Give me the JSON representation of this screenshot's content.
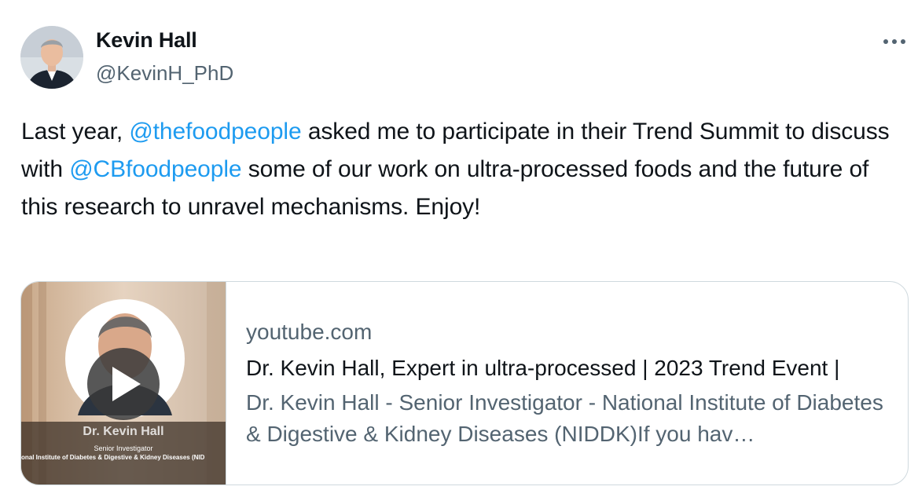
{
  "author": {
    "display_name": "Kevin Hall",
    "handle": "@KevinH_PhD",
    "avatar_icon": "profile-photo"
  },
  "more_icon": "more-horizontal-icon",
  "tweet": {
    "segments": [
      {
        "text": "Last year, ",
        "type": "text"
      },
      {
        "text": "@thefoodpeople",
        "type": "mention"
      },
      {
        "text": " asked me to participate in their Trend Summit to discuss with ",
        "type": "text"
      },
      {
        "text": "@CBfoodpeople",
        "type": "mention"
      },
      {
        "text": " some of our work on ultra-processed foods and the future of this research to unravel mechanisms. Enjoy!",
        "type": "text"
      }
    ]
  },
  "card": {
    "domain": "youtube.com",
    "title": "Dr. Kevin Hall, Expert in ultra-processed | 2023 Trend Event |",
    "description": "Dr. Kevin Hall - Senior Investigator - National Institute of Diabetes & Digestive & Kidney Diseases (NIDDK)If you hav…",
    "thumbnail": {
      "name_text": "Dr. Kevin Hall",
      "role_text": "Senior Investigator",
      "org_text": "onal Institute of Diabetes & Digestive & Kidney Diseases (NID",
      "play_icon": "play-icon"
    }
  },
  "colors": {
    "link": "#1d9bf0",
    "secondary_text": "#536471",
    "primary_text": "#0f1419",
    "border": "#cfd9de"
  }
}
